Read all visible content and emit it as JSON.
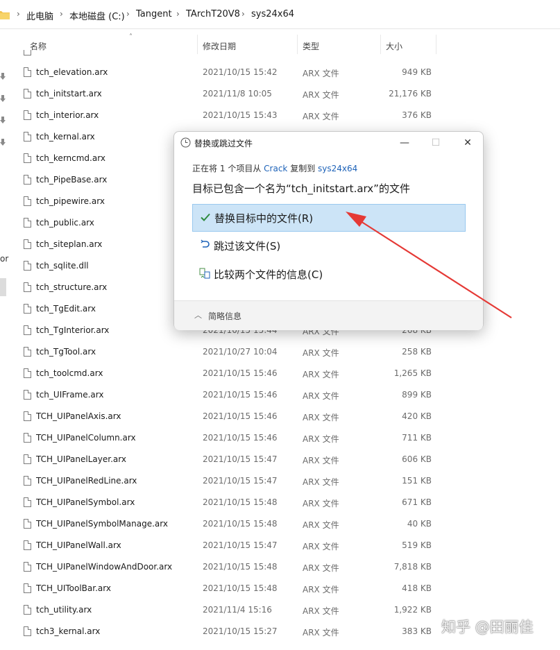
{
  "address": {
    "crumbs": [
      "此电脑",
      "本地磁盘 (C:)",
      "Tangent",
      "TArchT20V8",
      "sys24x64"
    ],
    "separator": "›"
  },
  "nav": {
    "partial_text": "or"
  },
  "columns": {
    "name": "名称",
    "modified": "修改日期",
    "type": "类型",
    "size": "大小"
  },
  "files": [
    {
      "name": "tch_elevation.arx",
      "date": "2021/10/15 15:42",
      "type": "ARX 文件",
      "size": "949 KB"
    },
    {
      "name": "tch_initstart.arx",
      "date": "2021/11/8 10:05",
      "type": "ARX 文件",
      "size": "21,176 KB"
    },
    {
      "name": "tch_interior.arx",
      "date": "2021/10/15 15:43",
      "type": "ARX 文件",
      "size": "376 KB"
    },
    {
      "name": "tch_kernal.arx",
      "date": "",
      "type": "",
      "size": ""
    },
    {
      "name": "tch_kerncmd.arx",
      "date": "",
      "type": "",
      "size": ""
    },
    {
      "name": "tch_PipeBase.arx",
      "date": "",
      "type": "",
      "size": ""
    },
    {
      "name": "tch_pipewire.arx",
      "date": "",
      "type": "",
      "size": ""
    },
    {
      "name": "tch_public.arx",
      "date": "",
      "type": "",
      "size": ""
    },
    {
      "name": "tch_siteplan.arx",
      "date": "",
      "type": "",
      "size": ""
    },
    {
      "name": "tch_sqlite.dll",
      "date": "",
      "type": "",
      "size": ""
    },
    {
      "name": "tch_structure.arx",
      "date": "",
      "type": "",
      "size": ""
    },
    {
      "name": "tch_TgEdit.arx",
      "date": "",
      "type": "",
      "size": ""
    },
    {
      "name": "tch_TgInterior.arx",
      "date": "2021/10/15 15:44",
      "type": "ARX 文件",
      "size": "268 KB"
    },
    {
      "name": "tch_TgTool.arx",
      "date": "2021/10/27 10:04",
      "type": "ARX 文件",
      "size": "258 KB"
    },
    {
      "name": "tch_toolcmd.arx",
      "date": "2021/10/15 15:46",
      "type": "ARX 文件",
      "size": "1,265 KB"
    },
    {
      "name": "tch_UIFrame.arx",
      "date": "2021/10/15 15:46",
      "type": "ARX 文件",
      "size": "899 KB"
    },
    {
      "name": "TCH_UIPanelAxis.arx",
      "date": "2021/10/15 15:46",
      "type": "ARX 文件",
      "size": "420 KB"
    },
    {
      "name": "TCH_UIPanelColumn.arx",
      "date": "2021/10/15 15:46",
      "type": "ARX 文件",
      "size": "711 KB"
    },
    {
      "name": "TCH_UIPanelLayer.arx",
      "date": "2021/10/15 15:47",
      "type": "ARX 文件",
      "size": "606 KB"
    },
    {
      "name": "TCH_UIPanelRedLine.arx",
      "date": "2021/10/15 15:47",
      "type": "ARX 文件",
      "size": "151 KB"
    },
    {
      "name": "TCH_UIPanelSymbol.arx",
      "date": "2021/10/15 15:48",
      "type": "ARX 文件",
      "size": "671 KB"
    },
    {
      "name": "TCH_UIPanelSymbolManage.arx",
      "date": "2021/10/15 15:48",
      "type": "ARX 文件",
      "size": "40 KB"
    },
    {
      "name": "TCH_UIPanelWall.arx",
      "date": "2021/10/15 15:47",
      "type": "ARX 文件",
      "size": "519 KB"
    },
    {
      "name": "TCH_UIPanelWindowAndDoor.arx",
      "date": "2021/10/15 15:48",
      "type": "ARX 文件",
      "size": "7,818 KB"
    },
    {
      "name": "TCH_UIToolBar.arx",
      "date": "2021/10/15 15:48",
      "type": "ARX 文件",
      "size": "418 KB"
    },
    {
      "name": "tch_utility.arx",
      "date": "2021/11/4 15:16",
      "type": "ARX 文件",
      "size": "1,922 KB"
    },
    {
      "name": "tch3_kernal.arx",
      "date": "2021/10/15 15:27",
      "type": "ARX 文件",
      "size": "383 KB"
    }
  ],
  "dialog": {
    "title": "替换或跳过文件",
    "desc_prefix": "正在将",
    "count": "1",
    "desc_mid": "个项目从",
    "source": "Crack",
    "desc_copy": "复制到",
    "target": "sys24x64",
    "headline": "目标已包含一个名为“tch_initstart.arx”的文件",
    "options": [
      {
        "label": "替换目标中的文件(R)",
        "icon": "check-icon"
      },
      {
        "label": "跳过该文件(S)",
        "icon": "skip-icon"
      },
      {
        "label": "比较两个文件的信息(C)",
        "icon": "compare-icon"
      }
    ],
    "more_info": "简略信息"
  },
  "colors": {
    "selected_option_bg": "#cce4f7",
    "link": "#1d62b8",
    "arrow": "#e53935"
  },
  "watermark": "知乎 @田丽佳"
}
